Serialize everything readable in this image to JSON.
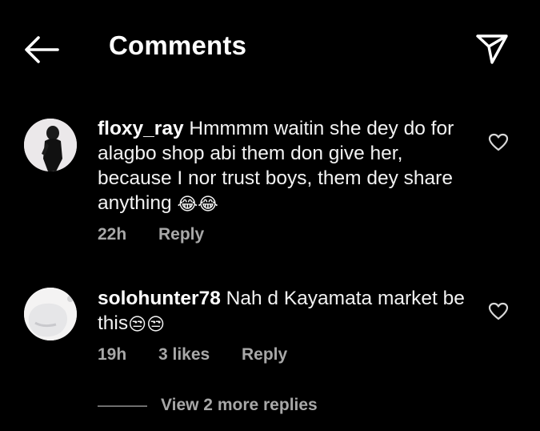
{
  "header": {
    "title": "Comments"
  },
  "comments": [
    {
      "username": "floxy_ray",
      "text": "Hmmmm waitin she dey do for alagbo shop abi them don give her, because I nor trust boys, them dey share anything",
      "emojis": "😂😂",
      "time": "22h",
      "likes": "",
      "reply_label": "Reply"
    },
    {
      "username": "solohunter78",
      "text": "Nah d Kayamata market be this",
      "emojis": "😒😒",
      "time": "19h",
      "likes": "3 likes",
      "reply_label": "Reply"
    }
  ],
  "replies": {
    "view_label": "View 2 more replies"
  },
  "colors": {
    "background": "#000000",
    "text": "#f2f2f2",
    "muted": "#a8a8a8"
  }
}
